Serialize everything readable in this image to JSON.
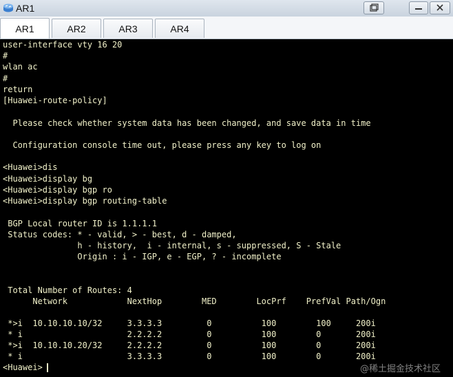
{
  "window": {
    "title": "AR1"
  },
  "tabs": [
    {
      "label": "AR1",
      "active": true
    },
    {
      "label": "AR2",
      "active": false
    },
    {
      "label": "AR3",
      "active": false
    },
    {
      "label": "AR4",
      "active": false
    }
  ],
  "terminal": {
    "lines": [
      "user-interface vty 16 20",
      "#",
      "wlan ac",
      "#",
      "return",
      "[Huawei-route-policy]",
      "",
      "  Please check whether system data has been changed, and save data in time",
      "",
      "  Configuration console time out, please press any key to log on",
      "",
      "<Huawei>dis",
      "<Huawei>display bg",
      "<Huawei>display bgp ro",
      "<Huawei>display bgp routing-table",
      "",
      " BGP Local router ID is 1.1.1.1",
      " Status codes: * - valid, > - best, d - damped,",
      "               h - history,  i - internal, s - suppressed, S - Stale",
      "               Origin : i - IGP, e - EGP, ? - incomplete",
      "",
      "",
      " Total Number of Routes: 4",
      "      Network            NextHop        MED        LocPrf    PrefVal Path/Ogn",
      "",
      " *>i  10.10.10.10/32     3.3.3.3         0          100        100     200i",
      " * i                     2.2.2.2         0          100        0       200i",
      " *>i  10.10.10.20/32     2.2.2.2         0          100        0       200i",
      " * i                     3.3.3.3         0          100        0       200i",
      "<Huawei>"
    ]
  },
  "watermark": "@稀土掘金技术社区",
  "colors": {
    "terminal_bg": "#000000",
    "terminal_text": "#f0f0c8"
  }
}
